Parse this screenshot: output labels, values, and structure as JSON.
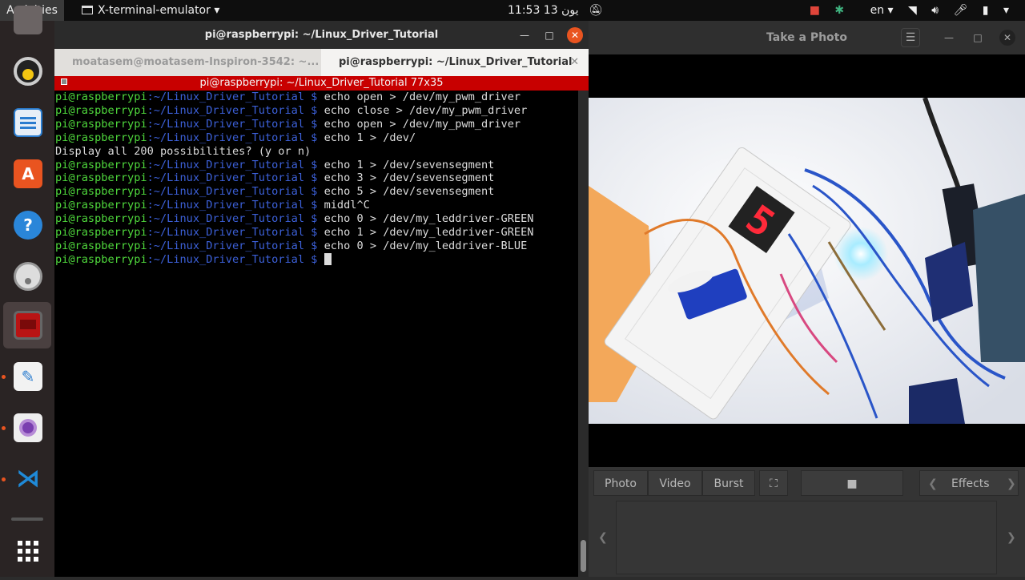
{
  "topbar": {
    "activities": "Activities",
    "app_name": "X-terminal-emulator",
    "clock": "11:53 يون 13",
    "lang": "en"
  },
  "dock": {
    "items": [
      {
        "name": "rhythmbox-icon"
      },
      {
        "name": "libreoffice-writer-icon"
      },
      {
        "name": "ubuntu-software-icon",
        "glyph": "A"
      },
      {
        "name": "help-icon",
        "glyph": "?"
      },
      {
        "name": "disk-icon"
      },
      {
        "name": "terminal-icon"
      },
      {
        "name": "text-editor-icon"
      },
      {
        "name": "cheese-icon"
      },
      {
        "name": "vscode-icon"
      },
      {
        "name": "show-apps-icon"
      }
    ]
  },
  "terminal": {
    "window_title": "pi@raspberrypi: ~/Linux_Driver_Tutorial",
    "tabs": [
      {
        "label": "moatasem@moatasem-Inspiron-3542: ~..."
      },
      {
        "label": "pi@raspberrypi: ~/Linux_Driver_Tutorial"
      }
    ],
    "xterm_title": "pi@raspberrypi: ~/Linux_Driver_Tutorial 77x35",
    "prompt_user": "pi@raspberrypi",
    "prompt_path": ":~/Linux_Driver_Tutorial $ ",
    "lines": [
      {
        "type": "cmd",
        "text": "echo open > /dev/my_pwm_driver"
      },
      {
        "type": "cmd",
        "text": "echo close > /dev/my_pwm_driver"
      },
      {
        "type": "cmd",
        "text": "echo open > /dev/my_pwm_driver"
      },
      {
        "type": "cmd",
        "text": "echo 1 > /dev/"
      },
      {
        "type": "out",
        "text": "Display all 200 possibilities? (y or n)"
      },
      {
        "type": "cmd",
        "text": "echo 1 > /dev/sevensegment"
      },
      {
        "type": "cmd",
        "text": "echo 3 > /dev/sevensegment"
      },
      {
        "type": "cmd",
        "text": "echo 5 > /dev/sevensegment"
      },
      {
        "type": "cmd",
        "text": "middl^C"
      },
      {
        "type": "cmd",
        "text": "echo 0 > /dev/my_leddriver-GREEN"
      },
      {
        "type": "cmd",
        "text": "echo 1 > /dev/my_leddriver-GREEN"
      },
      {
        "type": "cmd",
        "text": "echo 0 > /dev/my_leddriver-BLUE"
      },
      {
        "type": "cmd",
        "text": "",
        "cursor": true
      }
    ]
  },
  "cheese": {
    "title": "Take a Photo",
    "modes": [
      "Photo",
      "Video",
      "Burst"
    ],
    "effects_label": "Effects",
    "seven_segment_digit": "5"
  },
  "colors": {
    "prompt_user": "#4fd83c",
    "prompt_path": "#3c60d8",
    "xterm_title_bg": "#c80000",
    "close_button": "#e95420"
  }
}
